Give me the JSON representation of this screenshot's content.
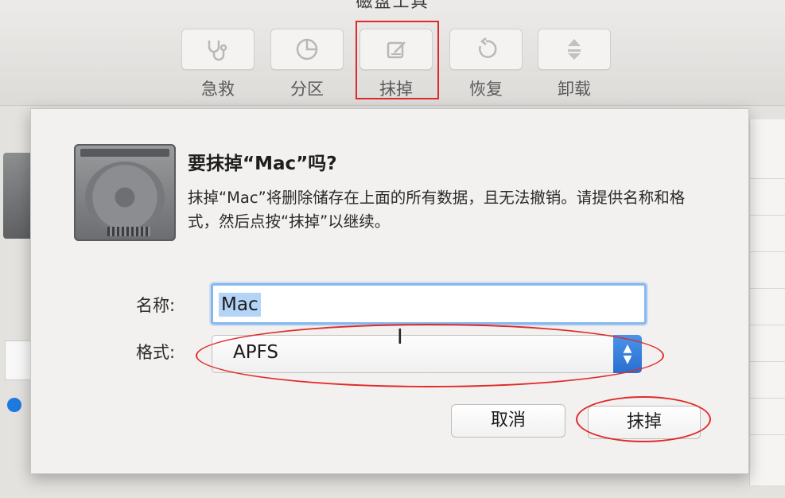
{
  "window": {
    "title": "磁盘工具"
  },
  "toolbar": {
    "items": [
      {
        "label": "急救",
        "icon": "stethoscope-icon"
      },
      {
        "label": "分区",
        "icon": "pie-chart-icon"
      },
      {
        "label": "抹掉",
        "icon": "erase-icon"
      },
      {
        "label": "恢复",
        "icon": "restore-icon"
      },
      {
        "label": "卸载",
        "icon": "unmount-icon"
      }
    ]
  },
  "dialog": {
    "title": "要抹掉“Mac”吗?",
    "message": "抹掉“Mac”将删除储存在上面的所有数据，且无法撤销。请提供名称和格式，然后点按“抹掉”以继续。",
    "name_label": "名称:",
    "name_value": "Mac",
    "format_label": "格式:",
    "format_value": "APFS",
    "cancel_label": "取消",
    "erase_label": "抹掉"
  },
  "colors": {
    "annotation": "#e02a2a",
    "accent": "#2a6fd0",
    "selection": "#b4d4f7"
  }
}
